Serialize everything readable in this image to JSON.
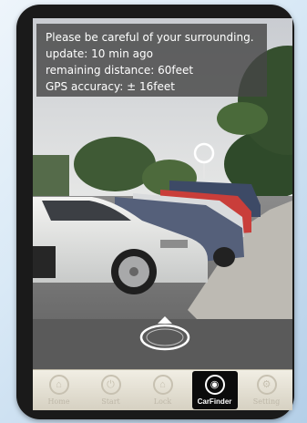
{
  "status": {
    "warning": "Please be careful of your surrounding.",
    "update": "update: 10 min ago",
    "distance": "remaining distance: 60feet",
    "gps": "GPS accuracy: ± 16feet"
  },
  "tabs": [
    {
      "label": "Home",
      "icon": "home-icon",
      "active": false
    },
    {
      "label": "Start",
      "icon": "power-icon",
      "active": false
    },
    {
      "label": "Lock",
      "icon": "lock-icon",
      "active": false
    },
    {
      "label": "CarFinder",
      "icon": "carfinder-icon",
      "active": true
    },
    {
      "label": "Setting",
      "icon": "gear-icon",
      "active": false
    }
  ]
}
